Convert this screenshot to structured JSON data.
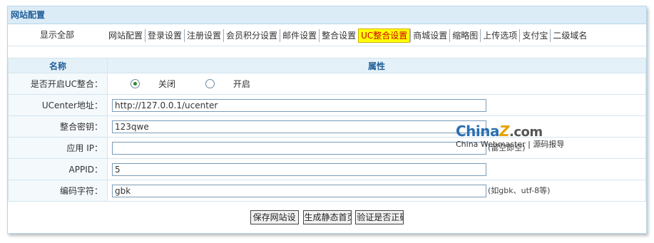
{
  "panel": {
    "title": "网站配置",
    "show_all": "显示全部"
  },
  "tabs": [
    "网站配置",
    "登录设置",
    "注册设置",
    "会员积分设置",
    "邮件设置",
    "整合设置",
    "UC整合设置",
    "商城设置",
    "缩略图",
    "上传选项",
    "支付宝",
    "二级域名"
  ],
  "active_tab_index": 6,
  "table": {
    "col_name": "名称",
    "col_attr": "属性",
    "rows": {
      "enable_uc": {
        "label": "是否开启UC整合：",
        "options": [
          "关闭",
          "开启"
        ],
        "selected": "关闭"
      },
      "uc_url": {
        "label": "UCenter地址：",
        "value": "http://127.0.0.1/ucenter"
      },
      "uc_key": {
        "label": "整合密钥：",
        "value": "123qwe"
      },
      "app_ip": {
        "label": "应用 IP：",
        "value": "",
        "hint": "(留空即空)"
      },
      "appid": {
        "label": "APPID：",
        "value": "5"
      },
      "charset": {
        "label": "编码字符：",
        "value": "gbk",
        "hint": "(如gbk、utf-8等)"
      }
    }
  },
  "buttons": {
    "save": "保存网站设",
    "static": "生成静态首页",
    "verify": "验证是否正确"
  },
  "watermark": {
    "logo_main": "China",
    "logo_z": "Z",
    "logo_com": ".com",
    "sub": "China Webmaster | 源码报导"
  },
  "colors": {
    "active_tab_bg": "#ffff00",
    "active_tab_text": "#cc0000",
    "header_bg": "#dbecf6"
  }
}
